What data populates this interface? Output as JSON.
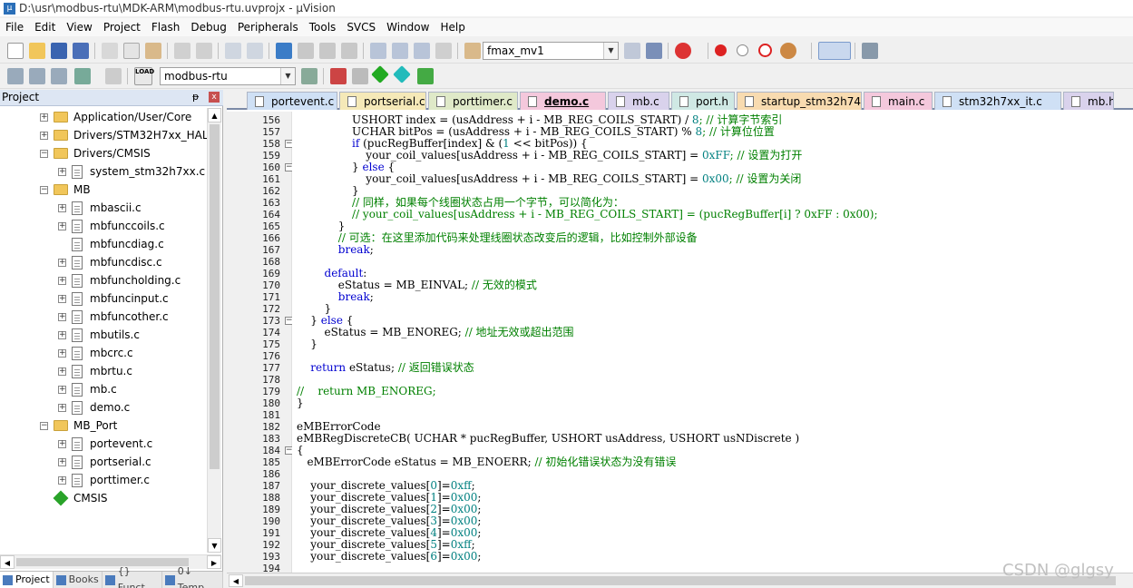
{
  "window": {
    "title": "D:\\usr\\modbus-rtu\\MDK-ARM\\modbus-rtu.uvprojx - µVision"
  },
  "menu": [
    "File",
    "Edit",
    "View",
    "Project",
    "Flash",
    "Debug",
    "Peripherals",
    "Tools",
    "SVCS",
    "Window",
    "Help"
  ],
  "toolbar1": {
    "target_combo": "fmax_mv1"
  },
  "toolbar2": {
    "project_combo": "modbus-rtu",
    "load_label": "LOAD"
  },
  "project_panel": {
    "title": "Project",
    "pin": "ᵽ",
    "close": "x",
    "tree": [
      {
        "label": "Application/User/Core",
        "type": "folder",
        "level": 1,
        "expand": "+"
      },
      {
        "label": "Drivers/STM32H7xx_HAL_D",
        "type": "folder",
        "level": 1,
        "expand": "+"
      },
      {
        "label": "Drivers/CMSIS",
        "type": "folder",
        "level": 1,
        "expand": "−"
      },
      {
        "label": "system_stm32h7xx.c",
        "type": "file",
        "level": 2,
        "expand": "+"
      },
      {
        "label": "MB",
        "type": "folder",
        "level": 1,
        "expand": "−"
      },
      {
        "label": "mbascii.c",
        "type": "file",
        "level": 2,
        "expand": "+"
      },
      {
        "label": "mbfunccoils.c",
        "type": "file",
        "level": 2,
        "expand": "+"
      },
      {
        "label": "mbfuncdiag.c",
        "type": "file",
        "level": 2,
        "expand": ""
      },
      {
        "label": "mbfuncdisc.c",
        "type": "file",
        "level": 2,
        "expand": "+"
      },
      {
        "label": "mbfuncholding.c",
        "type": "file",
        "level": 2,
        "expand": "+"
      },
      {
        "label": "mbfuncinput.c",
        "type": "file",
        "level": 2,
        "expand": "+"
      },
      {
        "label": "mbfuncother.c",
        "type": "file",
        "level": 2,
        "expand": "+"
      },
      {
        "label": "mbutils.c",
        "type": "file",
        "level": 2,
        "expand": "+"
      },
      {
        "label": "mbcrc.c",
        "type": "file",
        "level": 2,
        "expand": "+"
      },
      {
        "label": "mbrtu.c",
        "type": "file",
        "level": 2,
        "expand": "+"
      },
      {
        "label": "mb.c",
        "type": "file",
        "level": 2,
        "expand": "+"
      },
      {
        "label": "demo.c",
        "type": "file",
        "level": 2,
        "expand": "+"
      },
      {
        "label": "MB_Port",
        "type": "folder",
        "level": 1,
        "expand": "−"
      },
      {
        "label": "portevent.c",
        "type": "file",
        "level": 2,
        "expand": "+"
      },
      {
        "label": "portserial.c",
        "type": "file",
        "level": 2,
        "expand": "+"
      },
      {
        "label": "porttimer.c",
        "type": "file",
        "level": 2,
        "expand": "+"
      },
      {
        "label": "CMSIS",
        "type": "gem",
        "level": 1,
        "expand": ""
      }
    ],
    "bottom_tabs": [
      "Project",
      "Books",
      "{} Funct...",
      "0↓ Temp..."
    ]
  },
  "editor": {
    "active_tab": "demo.c",
    "tabs": [
      {
        "label": "portevent.c",
        "color": "#cfe0f5"
      },
      {
        "label": "portserial.c",
        "color": "#f5e9b8"
      },
      {
        "label": "porttimer.c",
        "color": "#dfe9c8"
      },
      {
        "label": "demo.c",
        "color": "#f4c8dc"
      },
      {
        "label": "mb.c",
        "color": "#d9d2ec"
      },
      {
        "label": "port.h",
        "color": "#cfe8e4"
      },
      {
        "label": "startup_stm32h743xx.s",
        "color": "#f8dbb0"
      },
      {
        "label": "main.c",
        "color": "#f4c8dc"
      },
      {
        "label": "stm32h7xx_it.c",
        "color": "#cfe0f5"
      },
      {
        "label": "mb.h",
        "color": "#d9d2ec"
      }
    ],
    "lines": [
      {
        "n": "156",
        "fold": "",
        "parts": [
          {
            "t": "                USHORT index = (usAddress + i - MB_REG_COILS_START) / ",
            "c": ""
          },
          {
            "t": "8",
            "c": "nm"
          },
          {
            "t": "; // 计算字节索引",
            "c": "cm"
          }
        ]
      },
      {
        "n": "157",
        "fold": "",
        "parts": [
          {
            "t": "                UCHAR bitPos = (usAddress + i - MB_REG_COILS_START) % ",
            "c": ""
          },
          {
            "t": "8",
            "c": "nm"
          },
          {
            "t": "; // 计算位位置",
            "c": "cm"
          }
        ]
      },
      {
        "n": "158",
        "fold": "−",
        "parts": [
          {
            "t": "                ",
            "c": ""
          },
          {
            "t": "if",
            "c": "kw"
          },
          {
            "t": " (pucRegBuffer[index] & (",
            "c": ""
          },
          {
            "t": "1",
            "c": "nm"
          },
          {
            "t": " << bitPos)) {",
            "c": ""
          }
        ]
      },
      {
        "n": "159",
        "fold": "",
        "parts": [
          {
            "t": "                    your_coil_values[usAddress + i - MB_REG_COILS_START] = ",
            "c": ""
          },
          {
            "t": "0xFF",
            "c": "nm"
          },
          {
            "t": "; // 设置为打开",
            "c": "cm"
          }
        ]
      },
      {
        "n": "160",
        "fold": "−",
        "parts": [
          {
            "t": "                } ",
            "c": ""
          },
          {
            "t": "else",
            "c": "kw"
          },
          {
            "t": " {",
            "c": ""
          }
        ]
      },
      {
        "n": "161",
        "fold": "",
        "parts": [
          {
            "t": "                    your_coil_values[usAddress + i - MB_REG_COILS_START] = ",
            "c": ""
          },
          {
            "t": "0x00",
            "c": "nm"
          },
          {
            "t": "; // 设置为关闭",
            "c": "cm"
          }
        ]
      },
      {
        "n": "162",
        "fold": "",
        "parts": [
          {
            "t": "                }",
            "c": ""
          }
        ]
      },
      {
        "n": "163",
        "fold": "",
        "parts": [
          {
            "t": "                // 同样，如果每个线圈状态占用一个字节，可以简化为：",
            "c": "cm"
          }
        ]
      },
      {
        "n": "164",
        "fold": "",
        "parts": [
          {
            "t": "                // your_coil_values[usAddress + i - MB_REG_COILS_START] = (pucRegBuffer[i] ? 0xFF : 0x00);",
            "c": "cm"
          }
        ]
      },
      {
        "n": "165",
        "fold": "",
        "parts": [
          {
            "t": "            }",
            "c": ""
          }
        ]
      },
      {
        "n": "166",
        "fold": "",
        "parts": [
          {
            "t": "            // 可选：在这里添加代码来处理线圈状态改变后的逻辑，比如控制外部设备",
            "c": "cm"
          }
        ]
      },
      {
        "n": "167",
        "fold": "",
        "parts": [
          {
            "t": "            ",
            "c": ""
          },
          {
            "t": "break",
            "c": "kw"
          },
          {
            "t": ";",
            "c": ""
          }
        ]
      },
      {
        "n": "168",
        "fold": "",
        "parts": [
          {
            "t": "",
            "c": ""
          }
        ]
      },
      {
        "n": "169",
        "fold": "",
        "parts": [
          {
            "t": "        ",
            "c": ""
          },
          {
            "t": "default",
            "c": "kw"
          },
          {
            "t": ":",
            "c": ""
          }
        ]
      },
      {
        "n": "170",
        "fold": "",
        "parts": [
          {
            "t": "            eStatus = MB_EINVAL; ",
            "c": ""
          },
          {
            "t": "// 无效的模式",
            "c": "cm"
          }
        ]
      },
      {
        "n": "171",
        "fold": "",
        "parts": [
          {
            "t": "            ",
            "c": ""
          },
          {
            "t": "break",
            "c": "kw"
          },
          {
            "t": ";",
            "c": ""
          }
        ]
      },
      {
        "n": "172",
        "fold": "",
        "parts": [
          {
            "t": "        }",
            "c": ""
          }
        ]
      },
      {
        "n": "173",
        "fold": "−",
        "parts": [
          {
            "t": "    } ",
            "c": ""
          },
          {
            "t": "else",
            "c": "kw"
          },
          {
            "t": " {",
            "c": ""
          }
        ]
      },
      {
        "n": "174",
        "fold": "",
        "parts": [
          {
            "t": "        eStatus = MB_ENOREG; ",
            "c": ""
          },
          {
            "t": "// 地址无效或超出范围",
            "c": "cm"
          }
        ]
      },
      {
        "n": "175",
        "fold": "",
        "parts": [
          {
            "t": "    }",
            "c": ""
          }
        ]
      },
      {
        "n": "176",
        "fold": "",
        "parts": [
          {
            "t": "",
            "c": ""
          }
        ]
      },
      {
        "n": "177",
        "fold": "",
        "parts": [
          {
            "t": "    ",
            "c": ""
          },
          {
            "t": "return",
            "c": "kw"
          },
          {
            "t": " eStatus; ",
            "c": ""
          },
          {
            "t": "// 返回错误状态",
            "c": "cm"
          }
        ]
      },
      {
        "n": "178",
        "fold": "",
        "parts": [
          {
            "t": "",
            "c": ""
          }
        ]
      },
      {
        "n": "179",
        "fold": "",
        "parts": [
          {
            "t": "//    return MB_ENOREG;",
            "c": "cm"
          }
        ]
      },
      {
        "n": "180",
        "fold": "",
        "parts": [
          {
            "t": "}",
            "c": ""
          }
        ]
      },
      {
        "n": "181",
        "fold": "",
        "parts": [
          {
            "t": "",
            "c": ""
          }
        ]
      },
      {
        "n": "182",
        "fold": "",
        "parts": [
          {
            "t": "eMBErrorCode",
            "c": ""
          }
        ]
      },
      {
        "n": "183",
        "fold": "",
        "parts": [
          {
            "t": "eMBRegDiscreteCB( UCHAR * pucRegBuffer, USHORT usAddress, USHORT usNDiscrete )",
            "c": ""
          }
        ]
      },
      {
        "n": "184",
        "fold": "−",
        "parts": [
          {
            "t": "{",
            "c": ""
          }
        ]
      },
      {
        "n": "185",
        "fold": "",
        "parts": [
          {
            "t": "   eMBErrorCode eStatus = MB_ENOERR; ",
            "c": ""
          },
          {
            "t": "// 初始化错误状态为没有错误",
            "c": "cm"
          }
        ]
      },
      {
        "n": "186",
        "fold": "",
        "parts": [
          {
            "t": "",
            "c": ""
          }
        ]
      },
      {
        "n": "187",
        "fold": "",
        "parts": [
          {
            "t": "    your_discrete_values[",
            "c": ""
          },
          {
            "t": "0",
            "c": "nm"
          },
          {
            "t": "]=",
            "c": ""
          },
          {
            "t": "0xff",
            "c": "nm"
          },
          {
            "t": ";",
            "c": ""
          }
        ]
      },
      {
        "n": "188",
        "fold": "",
        "parts": [
          {
            "t": "    your_discrete_values[",
            "c": ""
          },
          {
            "t": "1",
            "c": "nm"
          },
          {
            "t": "]=",
            "c": ""
          },
          {
            "t": "0x00",
            "c": "nm"
          },
          {
            "t": ";",
            "c": ""
          }
        ]
      },
      {
        "n": "189",
        "fold": "",
        "parts": [
          {
            "t": "    your_discrete_values[",
            "c": ""
          },
          {
            "t": "2",
            "c": "nm"
          },
          {
            "t": "]=",
            "c": ""
          },
          {
            "t": "0x00",
            "c": "nm"
          },
          {
            "t": ";",
            "c": ""
          }
        ]
      },
      {
        "n": "190",
        "fold": "",
        "parts": [
          {
            "t": "    your_discrete_values[",
            "c": ""
          },
          {
            "t": "3",
            "c": "nm"
          },
          {
            "t": "]=",
            "c": ""
          },
          {
            "t": "0x00",
            "c": "nm"
          },
          {
            "t": ";",
            "c": ""
          }
        ]
      },
      {
        "n": "191",
        "fold": "",
        "parts": [
          {
            "t": "    your_discrete_values[",
            "c": ""
          },
          {
            "t": "4",
            "c": "nm"
          },
          {
            "t": "]=",
            "c": ""
          },
          {
            "t": "0x00",
            "c": "nm"
          },
          {
            "t": ";",
            "c": ""
          }
        ]
      },
      {
        "n": "192",
        "fold": "",
        "parts": [
          {
            "t": "    your_discrete_values[",
            "c": ""
          },
          {
            "t": "5",
            "c": "nm"
          },
          {
            "t": "]=",
            "c": ""
          },
          {
            "t": "0xff",
            "c": "nm"
          },
          {
            "t": ";",
            "c": ""
          }
        ]
      },
      {
        "n": "193",
        "fold": "",
        "parts": [
          {
            "t": "    your_discrete_values[",
            "c": ""
          },
          {
            "t": "6",
            "c": "nm"
          },
          {
            "t": "]=",
            "c": ""
          },
          {
            "t": "0x00",
            "c": "nm"
          },
          {
            "t": ";",
            "c": ""
          }
        ]
      },
      {
        "n": "194",
        "fold": "",
        "parts": [
          {
            "t": "",
            "c": ""
          }
        ]
      }
    ]
  },
  "watermark": "CSDN @glgsy"
}
